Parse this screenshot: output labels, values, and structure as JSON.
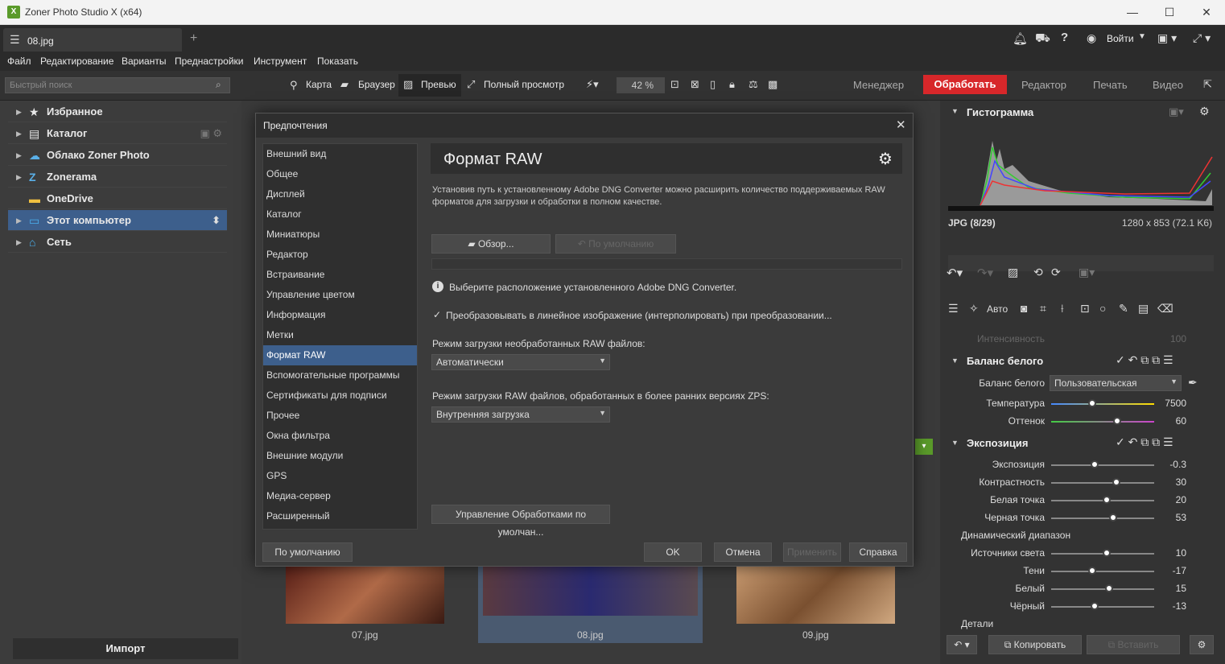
{
  "window": {
    "title": "Zoner Photo Studio X (x64)",
    "app_icon": "X"
  },
  "tab": {
    "label": "08.jpg"
  },
  "header_right": {
    "login": "Войти"
  },
  "menu": [
    "Файл",
    "Редактирование",
    "Варианты",
    "Преднастройки",
    "Инструмент",
    "Показать"
  ],
  "toolbar": {
    "search_placeholder": "Быстрый поиск",
    "map": "Карта",
    "browser": "Браузер",
    "preview": "Превью",
    "fullview": "Полный просмотр",
    "zoom": "42 %"
  },
  "modes": {
    "manager": "Менеджер",
    "process": "Обработать",
    "editor": "Редактор",
    "print": "Печать",
    "video": "Видео"
  },
  "nav": {
    "items": [
      {
        "label": "Избранное",
        "icon": "★"
      },
      {
        "label": "Каталог",
        "icon": "▤"
      },
      {
        "label": "Облако Zoner Photo",
        "icon": "☁"
      },
      {
        "label": "Zonerama",
        "icon": "Z"
      },
      {
        "label": "OneDrive",
        "icon": "▬"
      },
      {
        "label": "Этот компьютер",
        "icon": "▭"
      },
      {
        "label": "Сеть",
        "icon": "⌂"
      }
    ],
    "import": "Импорт"
  },
  "thumbs": [
    "07.jpg",
    "08.jpg",
    "09.jpg"
  ],
  "dialog": {
    "title": "Предпочтения",
    "categories": [
      "Внешний вид",
      "Общее",
      "Дисплей",
      "Каталог",
      "Миниатюры",
      "Редактор",
      "Встраивание",
      "Управление цветом",
      "Информация",
      "Метки",
      "Формат RAW",
      "Вспомогательные программы",
      "Сертификаты для подписи",
      "Прочее",
      "Окна фильтра",
      "Внешние модули",
      "GPS",
      "Медиа-сервер",
      "Расширенный"
    ],
    "selected_index": 10,
    "header": "Формат RAW",
    "description": "Установив путь к установленному Adobe DNG Converter можно расширить количество поддерживаемых RAW форматов для загрузки и обработки в полном качестве.",
    "browse": "Обзор...",
    "default_btn": "По умолчанию",
    "info": "Выберите расположение установленного Adobe DNG Converter.",
    "checkbox": "Преобразовывать в линейное изображение (интерполировать) при преобразовании...",
    "mode_label": "Режим загрузки необработанных RAW файлов:",
    "mode_value": "Автоматически",
    "mode2_label": "Режим загрузки RAW файлов, обработанных в более ранних версиях ZPS:",
    "mode2_value": "Внутренняя загрузка",
    "manage": "Управление Обработками по умолчан...",
    "footer": {
      "defaults": "По умолчанию",
      "ok": "OK",
      "cancel": "Отмена",
      "apply": "Применить",
      "help": "Справка"
    }
  },
  "right": {
    "histogram": "Гистограмма",
    "fileinfo": "JPG  (8/29)",
    "dims": "1280 x 853 (72.1 K6)",
    "auto": "Авто",
    "intensity": "Интенсивность",
    "intensity_val": "100",
    "wb_section": "Баланс белого",
    "wb_label": "Баланс белого",
    "wb_value": "Пользовательская",
    "temp_label": "Температура",
    "temp_val": "7500",
    "tint_label": "Оттенок",
    "tint_val": "60",
    "exp_section": "Экспозиция",
    "exp_rows": [
      {
        "label": "Экспозиция",
        "value": "-0.3",
        "pos": 0.42
      },
      {
        "label": "Контрастность",
        "value": "30",
        "pos": 0.63
      },
      {
        "label": "Белая точка",
        "value": "20",
        "pos": 0.54
      },
      {
        "label": "Черная точка",
        "value": "53",
        "pos": 0.6
      }
    ],
    "dyn": "Динамический диапазон",
    "dyn_rows": [
      {
        "label": "Источники света",
        "value": "10",
        "pos": 0.54
      },
      {
        "label": "Тени",
        "value": "-17",
        "pos": 0.4
      },
      {
        "label": "Белый",
        "value": "15",
        "pos": 0.56
      },
      {
        "label": "Чёрный",
        "value": "-13",
        "pos": 0.42
      }
    ],
    "details": "Детали",
    "copy": "Копировать",
    "paste": "Вставить"
  }
}
